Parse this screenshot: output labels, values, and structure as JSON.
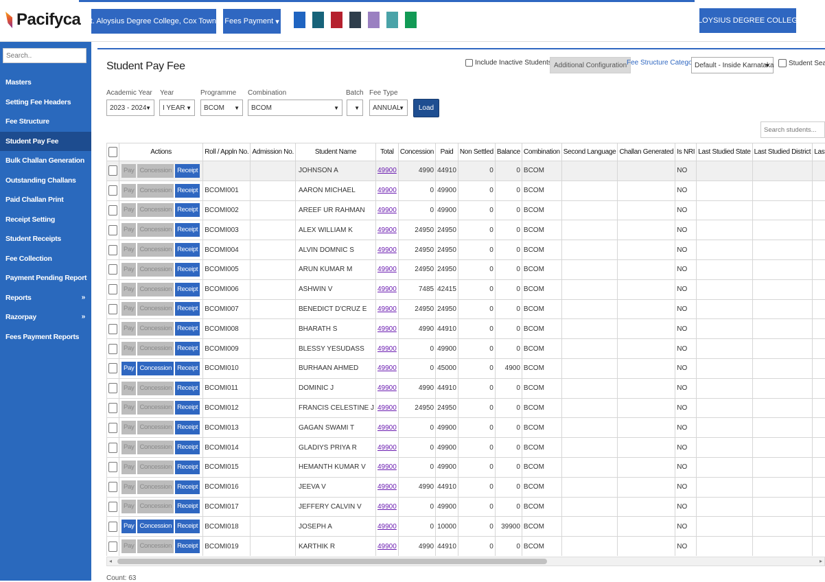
{
  "brand": {
    "name": "Pacifyca"
  },
  "topbar": {
    "college_select": "St. Aloysius Degree College, Cox Town",
    "module_select": "Fees Payment",
    "college_button": "ALOYSIUS DEGREE COLLEGE",
    "theme_colors": [
      "#1f64c1",
      "#17637a",
      "#b5202e",
      "#2f3e4c",
      "#9a80c1",
      "#4aa3a8",
      "#129a55"
    ]
  },
  "sidebar": {
    "search_placeholder": "Search..",
    "items": [
      {
        "label": "Masters"
      },
      {
        "label": "Setting Fee Headers"
      },
      {
        "label": "Fee Structure"
      },
      {
        "label": "Student Pay Fee",
        "active": true
      },
      {
        "label": "Bulk Challan Generation"
      },
      {
        "label": "Outstanding Challans"
      },
      {
        "label": "Paid Challan Print"
      },
      {
        "label": "Receipt Setting"
      },
      {
        "label": "Student Receipts"
      },
      {
        "label": "Fee Collection"
      },
      {
        "label": "Payment Pending Report"
      },
      {
        "label": "Reports",
        "chevron": "»"
      },
      {
        "label": "Razorpay",
        "chevron": "»"
      },
      {
        "label": "Fees Payment Reports"
      }
    ]
  },
  "page": {
    "title": "Student Pay Fee",
    "include_inactive": "Include Inactive Students",
    "additional_config": "Additional Configuration",
    "fee_structure_label": "Fee Structure Category",
    "fee_structure_value": "Default - Inside Karnataka",
    "student_search": "Student Sear",
    "search_students_placeholder": "Search students...",
    "count": "Count: 63"
  },
  "filters": {
    "academic_year": {
      "label": "Academic Year",
      "value": "2023 - 2024"
    },
    "year": {
      "label": "Year",
      "value": "I YEAR"
    },
    "programme": {
      "label": "Programme",
      "value": "BCOM"
    },
    "combination": {
      "label": "Combination",
      "value": "BCOM"
    },
    "batch": {
      "label": "Batch",
      "value": ""
    },
    "fee_type": {
      "label": "Fee Type",
      "value": "ANNUAL"
    },
    "load_label": "Load"
  },
  "table": {
    "headers": [
      "",
      "Actions",
      "Roll / Appln No.",
      "Admission No.",
      "Student Name",
      "Total",
      "Concession",
      "Paid",
      "Non Settled",
      "Balance",
      "Combination",
      "Second Language",
      "Challan Generated",
      "Is NRI",
      "Last Studied State",
      "Last Studied District",
      "Last"
    ],
    "action_labels": {
      "pay": "Pay",
      "concession": "Concession",
      "receipt": "Receipt"
    },
    "rows": [
      {
        "roll": "",
        "adm": "",
        "name": "JOHNSON A",
        "total": "49900",
        "concession": "4990",
        "paid": "44910",
        "non_settled": "0",
        "balance": "0",
        "combination": "BCOM",
        "nri": "NO",
        "enabled": false
      },
      {
        "roll": "BCOMI001",
        "adm": "",
        "name": "AARON MICHAEL",
        "total": "49900",
        "concession": "0",
        "paid": "49900",
        "non_settled": "0",
        "balance": "0",
        "combination": "BCOM",
        "nri": "NO",
        "enabled": false
      },
      {
        "roll": "BCOMI002",
        "adm": "",
        "name": "AREEF UR RAHMAN",
        "total": "49900",
        "concession": "0",
        "paid": "49900",
        "non_settled": "0",
        "balance": "0",
        "combination": "BCOM",
        "nri": "NO",
        "enabled": false
      },
      {
        "roll": "BCOMI003",
        "adm": "",
        "name": "ALEX WILLIAM K",
        "total": "49900",
        "concession": "24950",
        "paid": "24950",
        "non_settled": "0",
        "balance": "0",
        "combination": "BCOM",
        "nri": "NO",
        "enabled": false
      },
      {
        "roll": "BCOMI004",
        "adm": "",
        "name": "ALVIN DOMNIC S",
        "total": "49900",
        "concession": "24950",
        "paid": "24950",
        "non_settled": "0",
        "balance": "0",
        "combination": "BCOM",
        "nri": "NO",
        "enabled": false
      },
      {
        "roll": "BCOMI005",
        "adm": "",
        "name": "ARUN KUMAR M",
        "total": "49900",
        "concession": "24950",
        "paid": "24950",
        "non_settled": "0",
        "balance": "0",
        "combination": "BCOM",
        "nri": "NO",
        "enabled": false
      },
      {
        "roll": "BCOMI006",
        "adm": "",
        "name": "ASHWIN V",
        "total": "49900",
        "concession": "7485",
        "paid": "42415",
        "non_settled": "0",
        "balance": "0",
        "combination": "BCOM",
        "nri": "NO",
        "enabled": false
      },
      {
        "roll": "BCOMI007",
        "adm": "",
        "name": "BENEDICT D'CRUZ E",
        "total": "49900",
        "concession": "24950",
        "paid": "24950",
        "non_settled": "0",
        "balance": "0",
        "combination": "BCOM",
        "nri": "NO",
        "enabled": false
      },
      {
        "roll": "BCOMI008",
        "adm": "",
        "name": "BHARATH S",
        "total": "49900",
        "concession": "4990",
        "paid": "44910",
        "non_settled": "0",
        "balance": "0",
        "combination": "BCOM",
        "nri": "NO",
        "enabled": false
      },
      {
        "roll": "BCOMI009",
        "adm": "",
        "name": "BLESSY YESUDASS",
        "total": "49900",
        "concession": "0",
        "paid": "49900",
        "non_settled": "0",
        "balance": "0",
        "combination": "BCOM",
        "nri": "NO",
        "enabled": false
      },
      {
        "roll": "BCOMI010",
        "adm": "",
        "name": "BURHAAN AHMED",
        "total": "49900",
        "concession": "0",
        "paid": "45000",
        "non_settled": "0",
        "balance": "4900",
        "combination": "BCOM",
        "nri": "NO",
        "enabled": true
      },
      {
        "roll": "BCOMI011",
        "adm": "",
        "name": "DOMINIC J",
        "total": "49900",
        "concession": "4990",
        "paid": "44910",
        "non_settled": "0",
        "balance": "0",
        "combination": "BCOM",
        "nri": "NO",
        "enabled": false
      },
      {
        "roll": "BCOMI012",
        "adm": "",
        "name": "FRANCIS CELESTINE J",
        "total": "49900",
        "concession": "24950",
        "paid": "24950",
        "non_settled": "0",
        "balance": "0",
        "combination": "BCOM",
        "nri": "NO",
        "enabled": false
      },
      {
        "roll": "BCOMI013",
        "adm": "",
        "name": "GAGAN SWAMI T",
        "total": "49900",
        "concession": "0",
        "paid": "49900",
        "non_settled": "0",
        "balance": "0",
        "combination": "BCOM",
        "nri": "NO",
        "enabled": false
      },
      {
        "roll": "BCOMI014",
        "adm": "",
        "name": "GLADIYS PRIYA R",
        "total": "49900",
        "concession": "0",
        "paid": "49900",
        "non_settled": "0",
        "balance": "0",
        "combination": "BCOM",
        "nri": "NO",
        "enabled": false
      },
      {
        "roll": "BCOMI015",
        "adm": "",
        "name": "HEMANTH KUMAR V",
        "total": "49900",
        "concession": "0",
        "paid": "49900",
        "non_settled": "0",
        "balance": "0",
        "combination": "BCOM",
        "nri": "NO",
        "enabled": false
      },
      {
        "roll": "BCOMI016",
        "adm": "",
        "name": "JEEVA V",
        "total": "49900",
        "concession": "4990",
        "paid": "44910",
        "non_settled": "0",
        "balance": "0",
        "combination": "BCOM",
        "nri": "NO",
        "enabled": false
      },
      {
        "roll": "BCOMI017",
        "adm": "",
        "name": "JEFFERY CALVIN V",
        "total": "49900",
        "concession": "0",
        "paid": "49900",
        "non_settled": "0",
        "balance": "0",
        "combination": "BCOM",
        "nri": "NO",
        "enabled": false
      },
      {
        "roll": "BCOMI018",
        "adm": "",
        "name": "JOSEPH A",
        "total": "49900",
        "concession": "0",
        "paid": "10000",
        "non_settled": "0",
        "balance": "39900",
        "combination": "BCOM",
        "nri": "NO",
        "enabled": true
      },
      {
        "roll": "BCOMI019",
        "adm": "",
        "name": "KARTHIK R",
        "total": "49900",
        "concession": "4990",
        "paid": "44910",
        "non_settled": "0",
        "balance": "0",
        "combination": "BCOM",
        "nri": "NO",
        "enabled": false
      }
    ]
  }
}
